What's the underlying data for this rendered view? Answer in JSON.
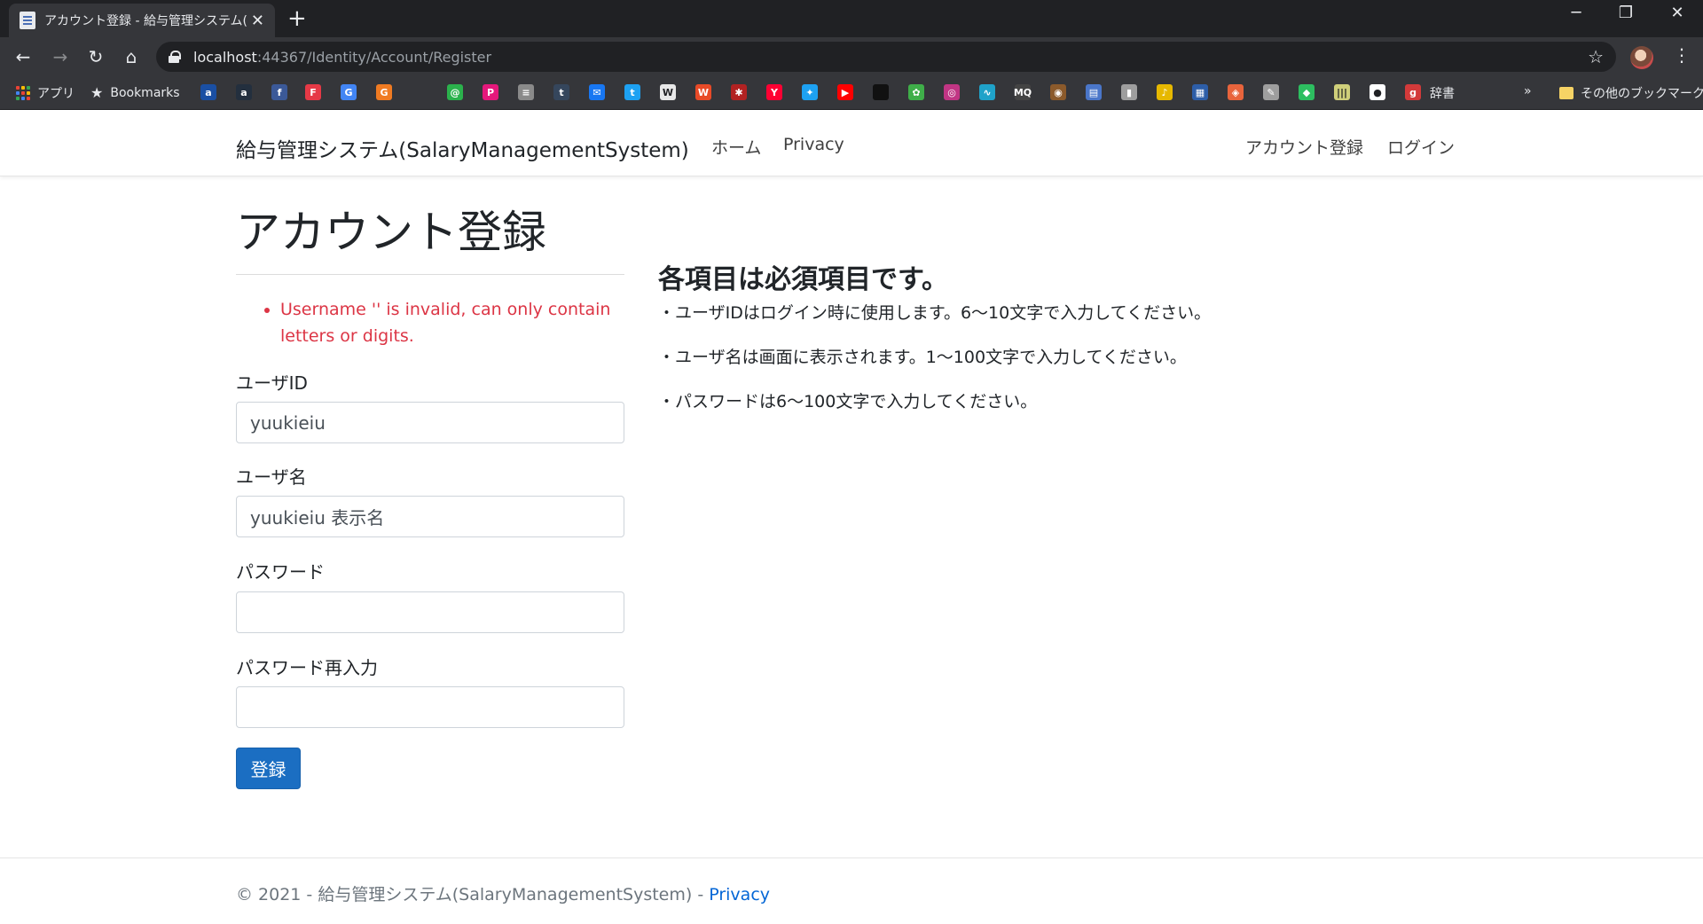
{
  "browser": {
    "tab_title": "アカウント登録 - 給与管理システム(S",
    "tab_close": "✕",
    "new_tab": "+",
    "controls": {
      "minimize": "─",
      "restore": "❐",
      "close": "✕"
    },
    "url_host": "localhost",
    "url_path": ":44367/Identity/Account/Register",
    "nav": {
      "back": "←",
      "forward": "→",
      "reload": "↻",
      "home": "⌂"
    },
    "bookmark_star": "☆",
    "menu": "⋮"
  },
  "bookmarks_bar": {
    "apps": "アプリ",
    "bookmarks": "Bookmarks",
    "dictionary": "辞書",
    "overflow": "»",
    "other": "その他のブックマーク",
    "icons": [
      {
        "name": "a-icon",
        "glyph": "a",
        "color": "#1a4fa3"
      },
      {
        "name": "amazon-icon",
        "glyph": "a",
        "color": "#232f3e"
      },
      {
        "name": "facebook-icon",
        "glyph": "f",
        "color": "#3b5998"
      },
      {
        "name": "f-red-icon",
        "glyph": "F",
        "color": "#e63946"
      },
      {
        "name": "google-icon",
        "glyph": "G",
        "color": "#4285f4"
      },
      {
        "name": "g-orange-icon",
        "glyph": "G",
        "color": "#f07b22"
      },
      {
        "name": "green-circle-icon",
        "glyph": "@",
        "color": "#2bb24c"
      },
      {
        "name": "p-pink-icon",
        "glyph": "P",
        "color": "#e5187b"
      },
      {
        "name": "doc-icon",
        "glyph": "≡",
        "color": "#8a8a8a"
      },
      {
        "name": "tumblr-icon",
        "glyph": "t",
        "color": "#35465c"
      },
      {
        "name": "messenger-icon",
        "glyph": "✉",
        "color": "#1877f2"
      },
      {
        "name": "twitter-box-icon",
        "glyph": "t",
        "color": "#1da1f2"
      },
      {
        "name": "wikipedia-icon",
        "glyph": "W",
        "color": "#e8e8e8"
      },
      {
        "name": "w-orange-icon",
        "glyph": "W",
        "color": "#e84a27"
      },
      {
        "name": "bug-icon",
        "glyph": "✱",
        "color": "#b22222"
      },
      {
        "name": "yahoo-icon",
        "glyph": "Y",
        "color": "#ff0033"
      },
      {
        "name": "twitter-icon",
        "glyph": "✦",
        "color": "#1da1f2"
      },
      {
        "name": "youtube-icon",
        "glyph": "▶",
        "color": "#ff0000"
      },
      {
        "name": "apple-icon",
        "glyph": "",
        "color": "#111111"
      },
      {
        "name": "frog-icon",
        "glyph": "✿",
        "color": "#3fae49"
      },
      {
        "name": "instagram-icon",
        "glyph": "◎",
        "color": "#c13584"
      },
      {
        "name": "pulse-icon",
        "glyph": "∿",
        "color": "#1fa2c9"
      },
      {
        "name": "mq-icon",
        "glyph": "MQ",
        "color": "#444444"
      },
      {
        "name": "owl-icon",
        "glyph": "◉",
        "color": "#8b5a2b"
      },
      {
        "name": "news-icon",
        "glyph": "▤",
        "color": "#4a76c9"
      },
      {
        "name": "book-icon",
        "glyph": "▮",
        "color": "#9e9e9e"
      },
      {
        "name": "note-icon",
        "glyph": "♪",
        "color": "#e6b800"
      },
      {
        "name": "aws-icon",
        "glyph": "▦",
        "color": "#2d5ea8"
      },
      {
        "name": "badge-icon",
        "glyph": "◈",
        "color": "#e8643c"
      },
      {
        "name": "pen-icon",
        "glyph": "✎",
        "color": "#9e9e9e"
      },
      {
        "name": "evernote-icon",
        "glyph": "◆",
        "color": "#2dbe60"
      },
      {
        "name": "barcode-icon",
        "glyph": "|||",
        "color": "#cfcf7a"
      },
      {
        "name": "github-icon",
        "glyph": "●",
        "color": "#ffffff"
      },
      {
        "name": "dictionary-icon",
        "glyph": "g",
        "color": "#d33a3a"
      }
    ]
  },
  "site": {
    "brand": "給与管理システム(SalaryManagementSystem)",
    "nav_home": "ホーム",
    "nav_privacy": "Privacy",
    "nav_register": "アカウント登録",
    "nav_login": "ログイン"
  },
  "form": {
    "title": "アカウント登録",
    "error": "Username '' is invalid, can only contain letters or digits.",
    "userid_label": "ユーザID",
    "userid_value": "yuukieiu",
    "username_label": "ユーザ名",
    "username_value": "yuukieiu 表示名",
    "password_label": "パスワード",
    "password_value": "",
    "confirm_label": "パスワード再入力",
    "confirm_value": "",
    "submit": "登録"
  },
  "info": {
    "heading": "各項目は必須項目です。",
    "line1": "・ユーザIDはログイン時に使用します。6～10文字で入力してください。",
    "line2": "・ユーザ名は画面に表示されます。1～100文字で入力してください。",
    "line3": "・パスワードは6～100文字で入力してください。"
  },
  "footer": {
    "text": "© 2021 - 給与管理システム(SalaryManagementSystem) - ",
    "privacy": "Privacy"
  }
}
